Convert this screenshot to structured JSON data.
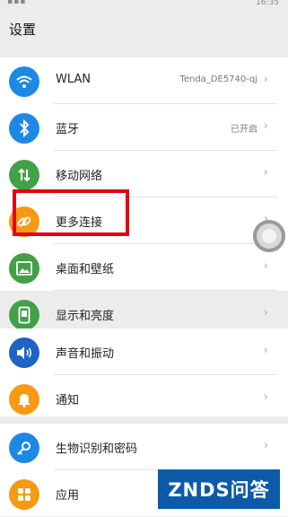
{
  "status_bar": {
    "left": "▪▪▪",
    "time": "16:35"
  },
  "title": "设置",
  "settings": [
    {
      "label": "WLAN",
      "value": "Tenda_DE5740-qj",
      "icon": "wifi-icon",
      "color": "#1e88e5"
    },
    {
      "label": "蓝牙",
      "value": "已开启",
      "icon": "bluetooth-icon",
      "color": "#1e88e5"
    },
    {
      "label": "移动网络",
      "value": "",
      "icon": "mobile-data-icon",
      "color": "#43a047"
    },
    {
      "label": "更多连接",
      "value": "",
      "icon": "link-icon",
      "color": "#f59a12"
    },
    {
      "label": "桌面和壁纸",
      "value": "",
      "icon": "image-icon",
      "color": "#43a047"
    },
    {
      "label": "显示和亮度",
      "value": "",
      "icon": "display-icon",
      "color": "#43a047"
    },
    {
      "label": "声音和振动",
      "value": "",
      "icon": "speaker-icon",
      "color": "#1e63c6"
    },
    {
      "label": "通知",
      "value": "",
      "icon": "bell-icon",
      "color": "#f59a12"
    },
    {
      "label": "生物识别和密码",
      "value": "",
      "icon": "key-icon",
      "color": "#1e88e5"
    },
    {
      "label": "应用",
      "value": "",
      "icon": "apps-grid-icon",
      "color": "#f59a12"
    }
  ],
  "watermark": "ZNDS问答",
  "chevron": "›"
}
